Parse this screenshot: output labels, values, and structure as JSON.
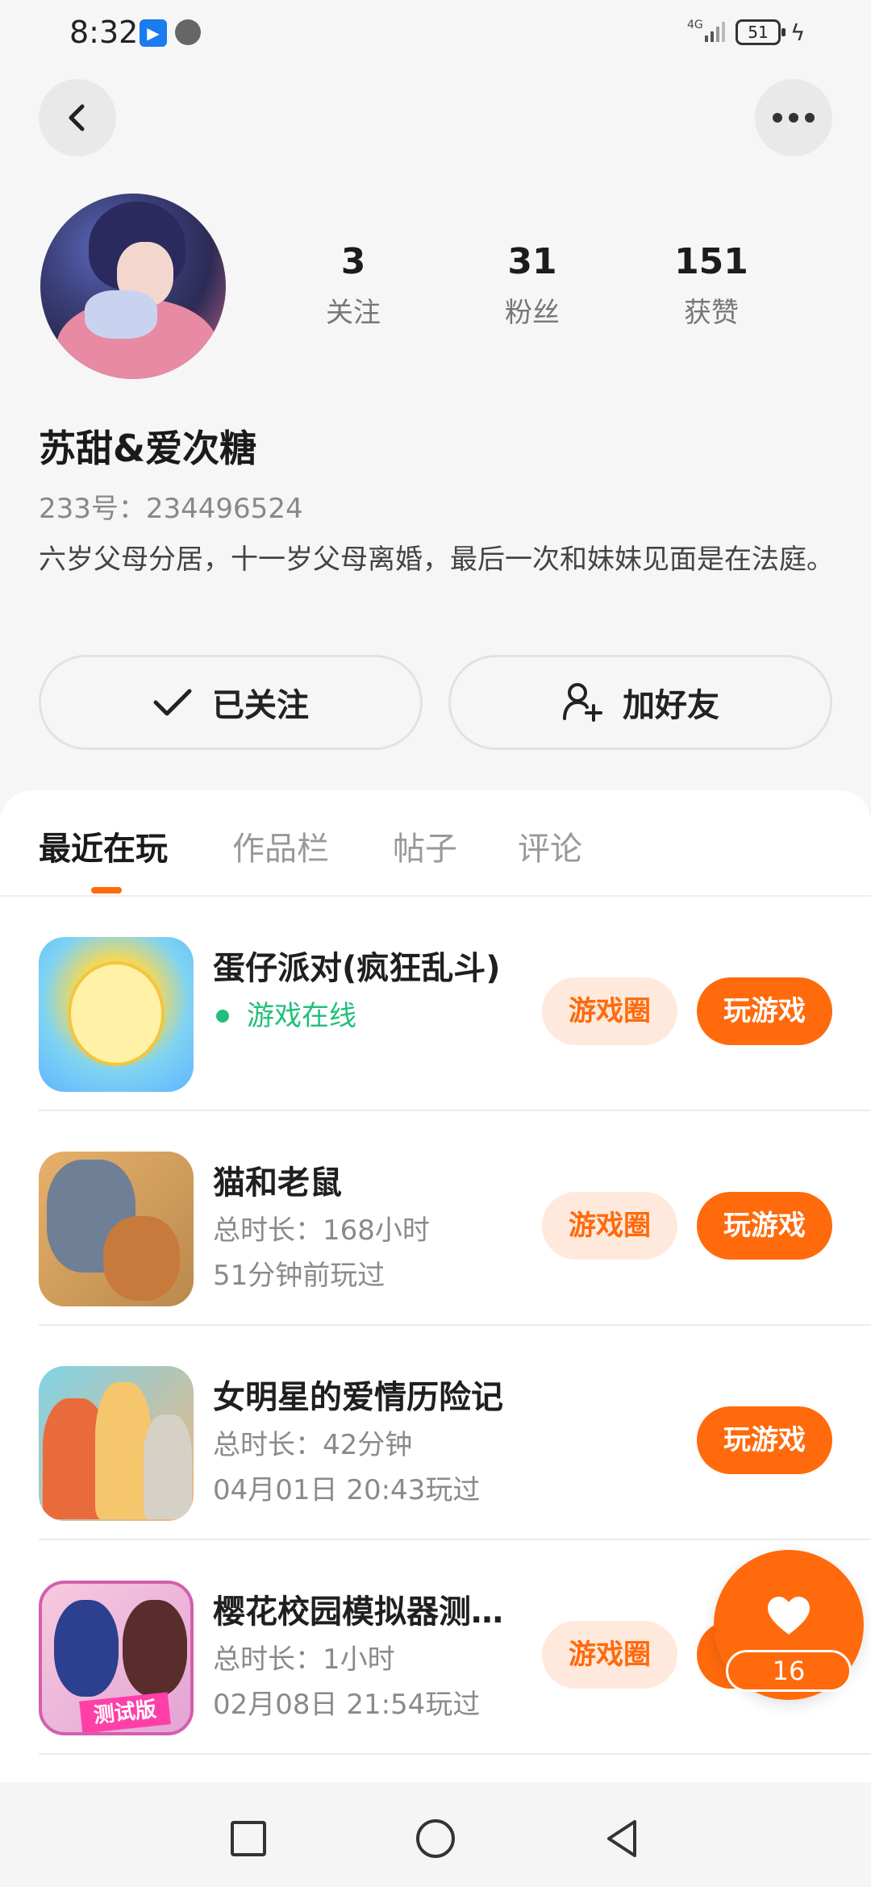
{
  "status_bar": {
    "time": "8:32",
    "network": "4G",
    "battery": "51"
  },
  "profile": {
    "stats": [
      {
        "num": "3",
        "label": "关注"
      },
      {
        "num": "31",
        "label": "粉丝"
      },
      {
        "num": "151",
        "label": "获赞"
      }
    ],
    "username": "苏甜&爱次糖",
    "uid": "233号：234496524",
    "bio": "六岁父母分居，十一岁父母离婚，最后一次和妹妹见面是在法庭。"
  },
  "actions": {
    "follow_label": "已关注",
    "add_friend_label": "加好友"
  },
  "tabs": [
    "最近在玩",
    "作品栏",
    "帖子",
    "评论"
  ],
  "games": [
    {
      "title": "蛋仔派对(疯狂乱斗)",
      "sub1": "游戏在线",
      "sub2": "",
      "circle_label": "游戏圈",
      "play_label": "玩游戏"
    },
    {
      "title": "猫和老鼠",
      "sub1": "总时长：168小时",
      "sub2": "51分钟前玩过",
      "circle_label": "游戏圈",
      "play_label": "玩游戏"
    },
    {
      "title": "女明星的爱情历险记",
      "sub1": "总时长：42分钟",
      "sub2": "04月01日 20:43玩过",
      "circle_label": "",
      "play_label": "玩游戏"
    },
    {
      "title": "樱花校园模拟器测试版",
      "sub1": "总时长：1小时",
      "sub2": "02月08日 21:54玩过",
      "circle_label": "游戏圈",
      "play_label": "玩游戏",
      "icon_badge": "测试版"
    }
  ],
  "floating_like": {
    "count": "16"
  },
  "colors": {
    "accent": "#ff6a0c",
    "online": "#21c07a",
    "circle_bg": "#ffe9dc"
  }
}
